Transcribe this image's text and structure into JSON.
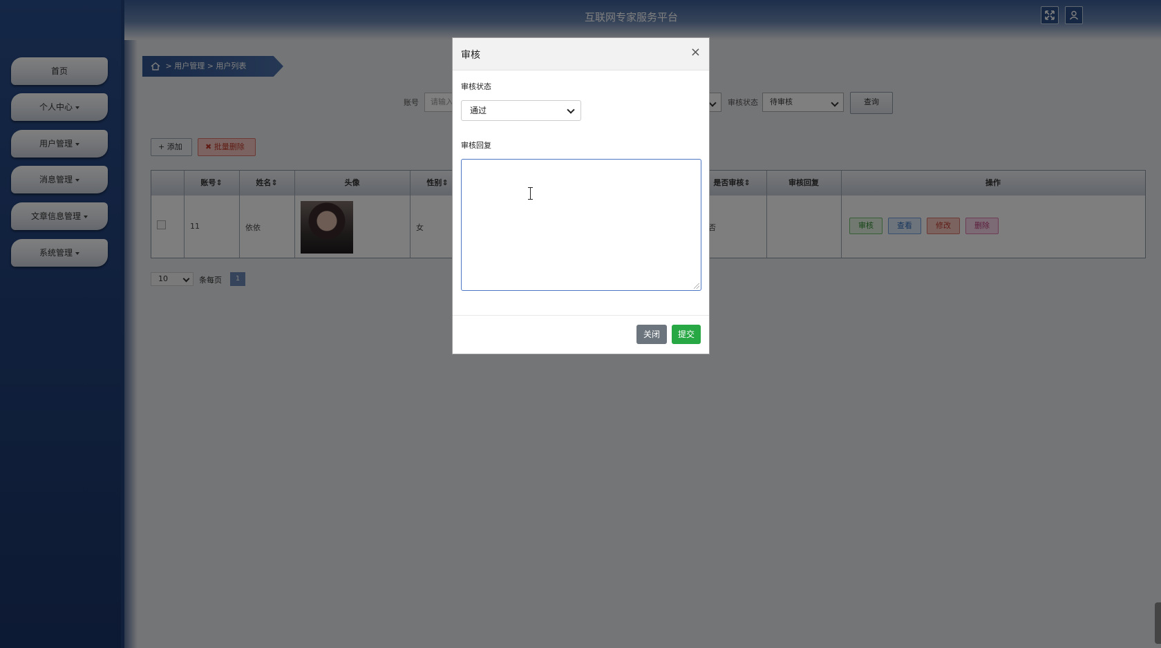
{
  "app": {
    "title": "互联网专家服务平台"
  },
  "sidebar": {
    "items": [
      {
        "label": "首页",
        "has_caret": false
      },
      {
        "label": "个人中心",
        "has_caret": true
      },
      {
        "label": "用户管理",
        "has_caret": true
      },
      {
        "label": "消息管理",
        "has_caret": true
      },
      {
        "label": "文章信息管理",
        "has_caret": true
      },
      {
        "label": "系统管理",
        "has_caret": true
      }
    ]
  },
  "topbar": {
    "icons": [
      "fullscreen-icon",
      "user-icon"
    ]
  },
  "breadcrumb": {
    "icon": "home-icon",
    "text": "> 用户管理 > 用户列表"
  },
  "search": {
    "account_label": "账号",
    "account_placeholder": "请输入",
    "review_status_label": "审核状态",
    "review_status_value": "待审核",
    "query_label": "查询"
  },
  "toolbar": {
    "add_label": "+ 添加",
    "batch_delete_label": "✖ 批量删除"
  },
  "table": {
    "headers": [
      "账号",
      "姓名",
      "头像",
      "性别",
      "是否审核",
      "审核回复",
      "操作"
    ],
    "rows": [
      {
        "account": "11",
        "name": "依依",
        "gender": "女",
        "reviewed": "否",
        "reply": ""
      }
    ],
    "actions": [
      "审核",
      "查看",
      "修改",
      "删除"
    ]
  },
  "pager": {
    "page_size": "10",
    "per_page_text": "条每页",
    "current_page": "1"
  },
  "modal": {
    "title": "审核",
    "close_symbol": "×",
    "status_label": "审核状态",
    "status_value": "通过",
    "reply_label": "审核回复",
    "reply_value": "",
    "close_button": "关闭",
    "submit_button": "提交"
  }
}
